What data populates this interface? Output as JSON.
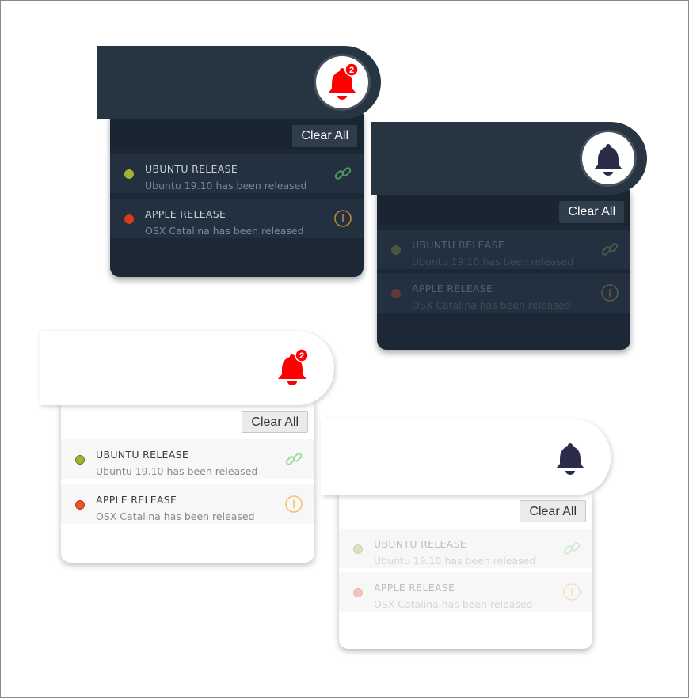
{
  "colors": {
    "dark_header": "#273442",
    "dark_panel": "#1c2836",
    "bell_active": "#ff0000",
    "bell_inactive": "#2b2c4a",
    "badge": "#ff0000",
    "dot_ubuntu": "#a4b233",
    "dot_apple": "#f0522c",
    "link_icon": "#7bd17b",
    "info_icon": "#f5b14a"
  },
  "widgets": [
    {
      "theme": "dark",
      "bell_icon": "bell-icon",
      "badge_count": "2",
      "clear_label": "Clear All",
      "notifications": [
        {
          "title": "UBUNTU RELEASE",
          "message": "Ubuntu 19.10 has been released",
          "icon": "link-icon"
        },
        {
          "title": "APPLE RELEASE",
          "message": "OSX Catalina has been released",
          "icon": "info-icon"
        }
      ]
    },
    {
      "theme": "dark",
      "bell_icon": "bell-icon",
      "clear_label": "Clear All",
      "notifications": [
        {
          "title": "UBUNTU RELEASE",
          "message": "Ubuntu 19.10 has been released",
          "icon": "link-icon"
        },
        {
          "title": "APPLE RELEASE",
          "message": "OSX Catalina has been released",
          "icon": "info-icon"
        }
      ]
    },
    {
      "theme": "light",
      "bell_icon": "bell-icon",
      "badge_count": "2",
      "clear_label": "Clear All",
      "notifications": [
        {
          "title": "UBUNTU RELEASE",
          "message": "Ubuntu 19.10 has been released",
          "icon": "link-icon"
        },
        {
          "title": "APPLE RELEASE",
          "message": "OSX Catalina has been released",
          "icon": "info-icon"
        }
      ]
    },
    {
      "theme": "light",
      "bell_icon": "bell-icon",
      "clear_label": "Clear All",
      "notifications": [
        {
          "title": "UBUNTU RELEASE",
          "message": "Ubuntu 19.10 has been released",
          "icon": "link-icon"
        },
        {
          "title": "APPLE RELEASE",
          "message": "OSX Catalina has been released",
          "icon": "info-icon"
        }
      ]
    }
  ]
}
